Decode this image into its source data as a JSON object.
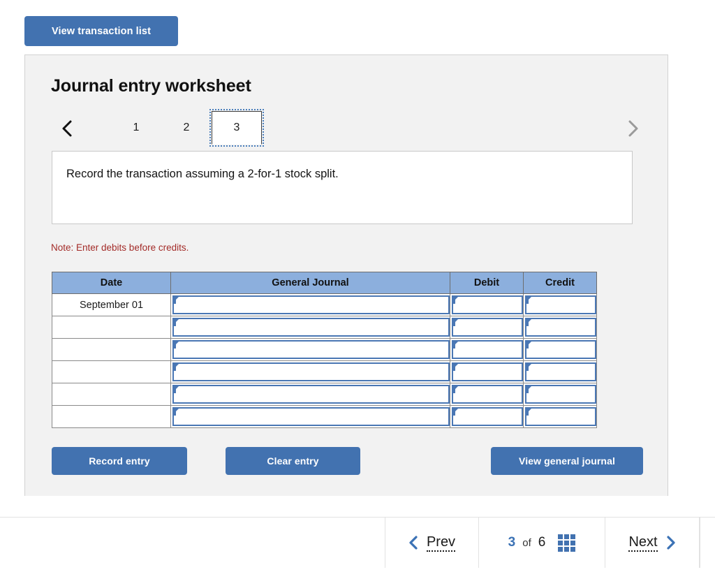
{
  "toolbar": {
    "view_transaction_list": "View transaction list"
  },
  "worksheet": {
    "title": "Journal entry worksheet",
    "prev_arrow_icon": "chevron-left-icon",
    "next_arrow_icon": "chevron-right-icon",
    "tabs": [
      {
        "label": "1",
        "active": false
      },
      {
        "label": "2",
        "active": false
      },
      {
        "label": "3",
        "active": true
      }
    ],
    "instruction": "Record the transaction assuming a 2-for-1 stock split.",
    "note": "Note: Enter debits before credits.",
    "note_color": "#a32b28"
  },
  "journal_table": {
    "headers": [
      "Date",
      "General Journal",
      "Debit",
      "Credit"
    ],
    "rows": [
      {
        "date": "September 01",
        "general_journal": "",
        "debit": "",
        "credit": ""
      },
      {
        "date": "",
        "general_journal": "",
        "debit": "",
        "credit": ""
      },
      {
        "date": "",
        "general_journal": "",
        "debit": "",
        "credit": ""
      },
      {
        "date": "",
        "general_journal": "",
        "debit": "",
        "credit": ""
      },
      {
        "date": "",
        "general_journal": "",
        "debit": "",
        "credit": ""
      },
      {
        "date": "",
        "general_journal": "",
        "debit": "",
        "credit": ""
      }
    ],
    "header_bg": "#8cafdd",
    "input_border_color": "#4a77b4"
  },
  "actions": {
    "record_entry": "Record entry",
    "clear_entry": "Clear entry",
    "view_general_journal": "View general journal"
  },
  "pager": {
    "prev_label": "Prev",
    "prev_icon": "chevron-left-icon",
    "current_page": "3",
    "of_label": "of",
    "total_pages": "6",
    "grid_icon": "grid-3x3-icon",
    "next_label": "Next",
    "next_icon": "chevron-right-icon",
    "accent_color": "#3b72b5"
  }
}
